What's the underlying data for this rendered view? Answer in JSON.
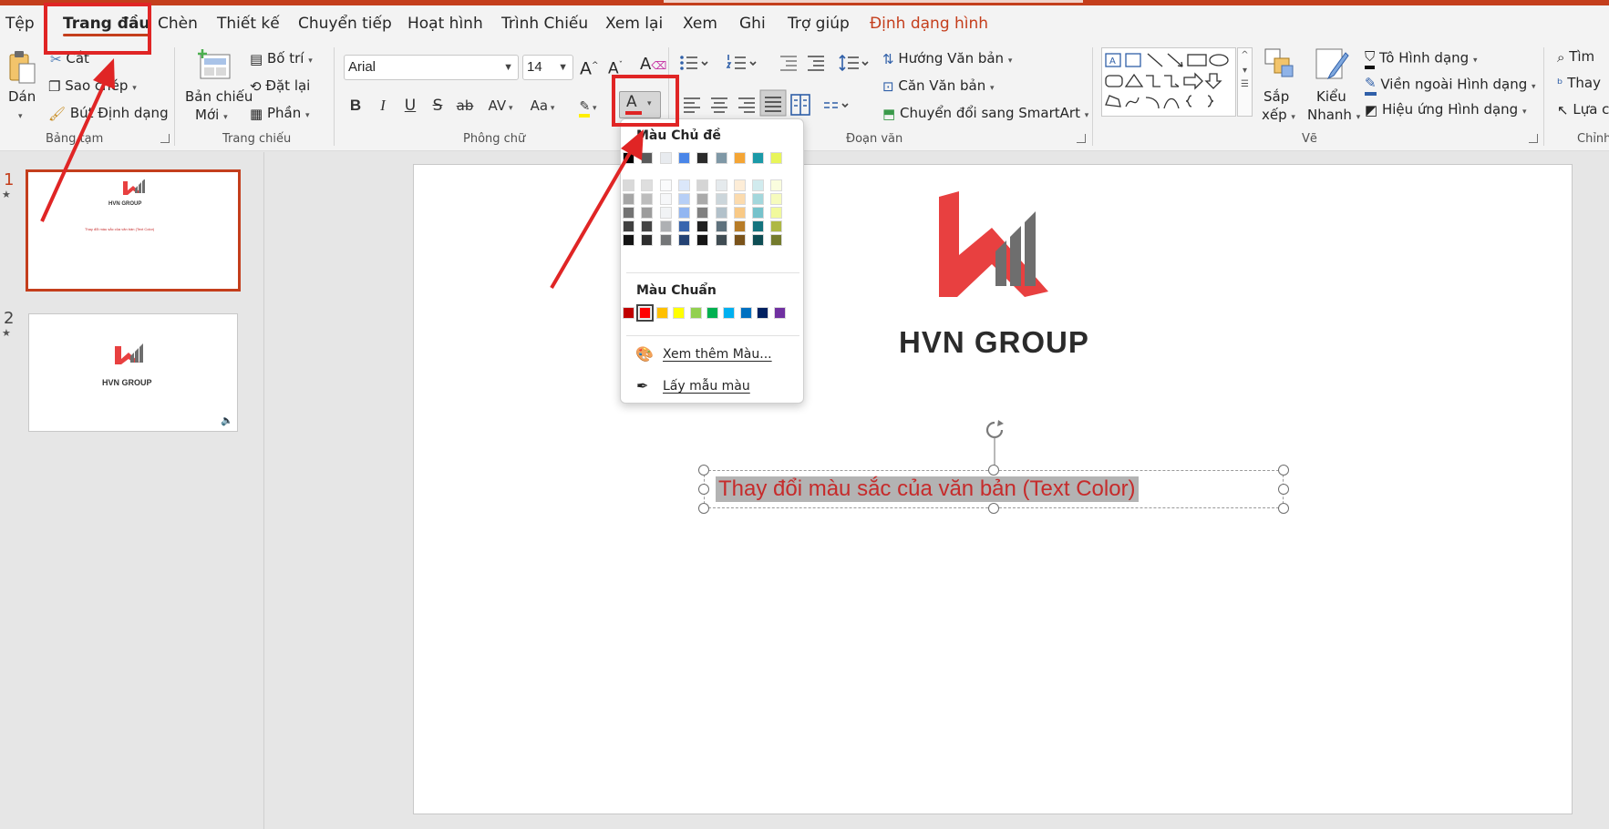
{
  "menu": {
    "tabs": [
      {
        "label": "Tệp"
      },
      {
        "label": "Trang đầu"
      },
      {
        "label": "Chèn"
      },
      {
        "label": "Thiết kế"
      },
      {
        "label": "Chuyển tiếp"
      },
      {
        "label": "Hoạt hình"
      },
      {
        "label": "Trình Chiếu"
      },
      {
        "label": "Xem lại"
      },
      {
        "label": "Xem"
      },
      {
        "label": "Ghi"
      },
      {
        "label": "Trợ giúp"
      },
      {
        "label": "Định dạng hình"
      }
    ]
  },
  "ribbon": {
    "clipboard": {
      "paste": "Dán",
      "cut": "Cắt",
      "copy": "Sao chép",
      "format_painter": "Bút Định dạng",
      "group": "Bảng tạm"
    },
    "slides": {
      "new_slide_1": "Bản chiếu",
      "new_slide_2": "Mới",
      "layout": "Bố trí",
      "reset": "Đặt lại",
      "section": "Phần",
      "group": "Trang chiếu"
    },
    "font": {
      "name": "Arial",
      "size": "14",
      "bold": "B",
      "italic": "I",
      "underline": "U",
      "strike": "S",
      "shadow_strike": "ab",
      "spacing": "AV",
      "case": "Aa",
      "font_color_glyph": "A",
      "group": "Phông chữ"
    },
    "paragraph": {
      "text_direction": "Hướng Văn bản",
      "align_text": "Căn Văn bản",
      "smartart": "Chuyển đổi sang SmartArt",
      "group": "Đoạn văn"
    },
    "drawing": {
      "arrange_1": "Sắp",
      "arrange_2": "xếp",
      "quick_styles_1": "Kiểu",
      "quick_styles_2": "Nhanh",
      "shape_fill": "Tô Hình dạng",
      "shape_outline": "Viền ngoài Hình dạng",
      "shape_effects": "Hiệu ứng Hình dạng",
      "group": "Vẽ"
    },
    "editing": {
      "find": "Tìm",
      "replace": "Thay",
      "select": "Lựa c",
      "group": "Chỉnh"
    }
  },
  "thumbnails": [
    {
      "number": "1",
      "brand": "HVN GROUP",
      "caption": "Thay đổi màu sắc của văn bản (Text Color)"
    },
    {
      "number": "2",
      "brand": "HVN GROUP"
    }
  ],
  "slide": {
    "brand": "HVN GROUP",
    "selected_text": "Thay đổi màu sắc của văn bản (Text Color)"
  },
  "color_menu": {
    "theme_header": "Màu Chủ đề",
    "standard_header": "Màu Chuẩn",
    "more_colors": "Xem thêm Màu...",
    "eyedropper": "Lấy mẫu màu",
    "theme_colors": [
      "#000000",
      "#5a5a5a",
      "#e8ebef",
      "#4a86e8",
      "#2b2b2b",
      "#7f98a6",
      "#f4a535",
      "#1b9aa8",
      "#e8f55a"
    ],
    "standard_colors": [
      "#c00000",
      "#ff0000",
      "#ffc000",
      "#ffff00",
      "#92d050",
      "#00b050",
      "#00b0f0",
      "#0070c0",
      "#002060",
      "#7030a0"
    ]
  },
  "colors": {
    "accent": "#c43e1c",
    "selected_text": "#c62b2b",
    "logo_red": "#e84040",
    "logo_grey": "#6e6e6e",
    "annotation": "#e02525"
  }
}
